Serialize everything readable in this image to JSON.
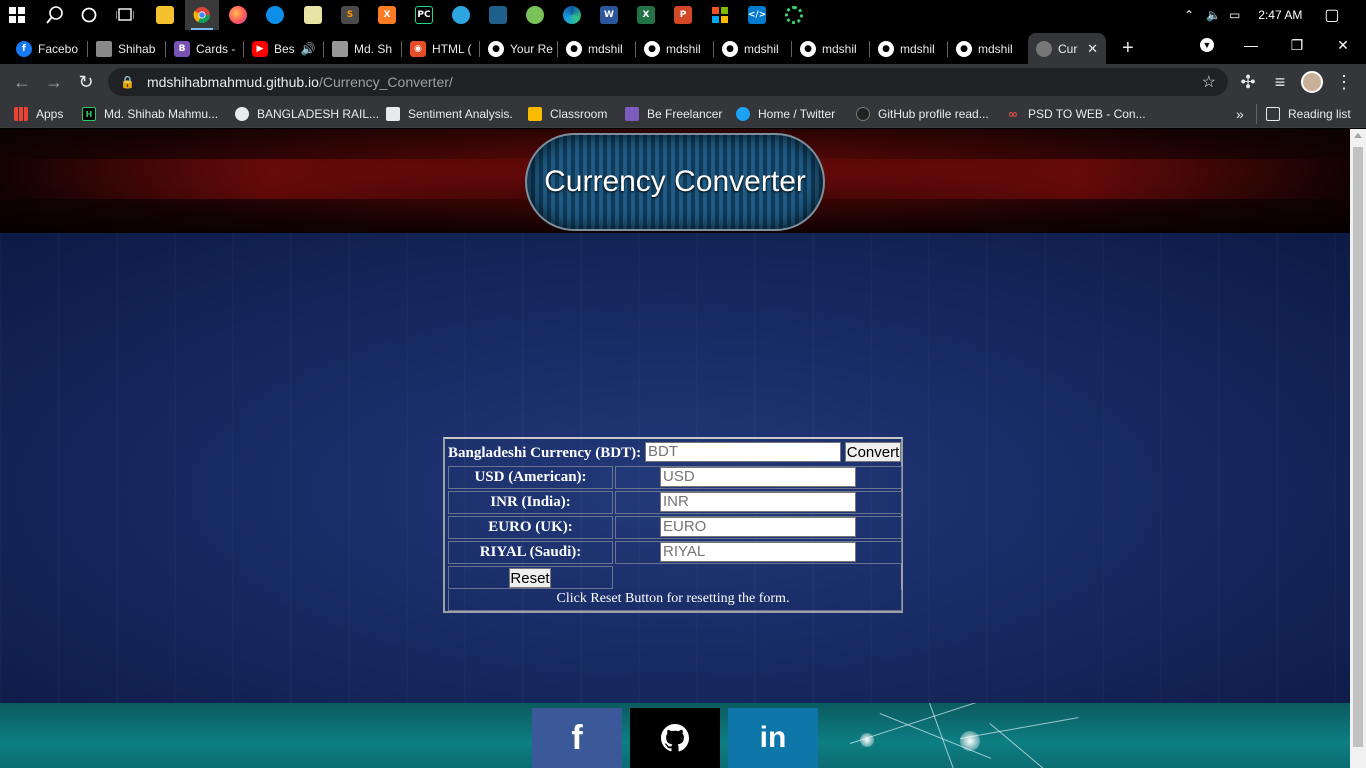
{
  "taskbar": {
    "time": "2:47 AM",
    "apps": [
      "start-icon",
      "search-icon",
      "cortana-icon",
      "task-view-icon",
      "file-explorer-icon",
      "chrome-icon",
      "firefox-icon",
      "teamviewer-icon",
      "notepad-icon",
      "sublime-icon",
      "xampp-icon",
      "pycharm-icon",
      "telegram-icon",
      "blend-icon",
      "android-icon",
      "edge-icon",
      "word-icon",
      "excel-icon",
      "powerpoint-icon",
      "office-icon",
      "vscode-icon",
      "recorder-icon"
    ],
    "colors": {
      "word": "#2b579a",
      "excel": "#217346",
      "powerpoint": "#d24726",
      "vscode": "#007acc"
    }
  },
  "tabs": [
    {
      "label": "Facebo",
      "icon": "facebook-icon"
    },
    {
      "label": "Shihab",
      "icon": "profile-icon"
    },
    {
      "label": "Cards -",
      "icon": "bootstrap-icon"
    },
    {
      "label": "Bes",
      "icon": "youtube-icon"
    },
    {
      "label": "Md. Sh",
      "icon": "profile-icon"
    },
    {
      "label": "HTML (",
      "icon": "html-icon"
    },
    {
      "label": "Your Re",
      "icon": "github-icon"
    },
    {
      "label": "mdshil",
      "icon": "github-icon"
    },
    {
      "label": "mdshil",
      "icon": "github-icon"
    },
    {
      "label": "mdshil",
      "icon": "github-icon"
    },
    {
      "label": "mdshil",
      "icon": "github-icon"
    },
    {
      "label": "mdshil",
      "icon": "github-icon"
    },
    {
      "label": "mdshil",
      "icon": "github-icon"
    },
    {
      "label": "Cur",
      "icon": "globe-icon",
      "active": true
    }
  ],
  "address": {
    "host": "mdshihabmahmud.github.io",
    "path": "/Currency_Converter/"
  },
  "bookmarks": [
    {
      "label": "Apps",
      "icon": "apps-icon"
    },
    {
      "label": "Md. Shihab Mahmu...",
      "icon": "hackerrank-icon"
    },
    {
      "label": "BANGLADESH RAIL...",
      "icon": "globe-icon"
    },
    {
      "label": "Sentiment Analysis.",
      "icon": "doc-icon"
    },
    {
      "label": "Classroom",
      "icon": "classroom-icon"
    },
    {
      "label": "Be Freelancer",
      "icon": "freelancer-icon"
    },
    {
      "label": "Home / Twitter",
      "icon": "twitter-icon"
    },
    {
      "label": "GitHub profile read...",
      "icon": "github-icon"
    },
    {
      "label": "PSD TO WEB - Con...",
      "icon": "link-icon"
    }
  ],
  "bookmarks_more": "»",
  "reading_list": "Reading list",
  "page": {
    "title": "Currency Converter",
    "converter": {
      "bdt_label": "Bangladeshi Currency (BDT):",
      "bdt_placeholder": "BDT",
      "convert_label": "Convert",
      "usd_label": "USD (American):",
      "usd_placeholder": "USD",
      "inr_label": "INR (India):",
      "inr_placeholder": "INR",
      "euro_label": "EURO (UK):",
      "euro_placeholder": "EURO",
      "riyal_label": "RIYAL (Saudi):",
      "riyal_placeholder": "RIYAL",
      "reset_label": "Reset",
      "note": "Click Reset Button for resetting the form."
    },
    "footer_links": [
      {
        "label": "f",
        "icon": "facebook-icon",
        "color": "#3b5998"
      },
      {
        "label": "",
        "icon": "github-icon",
        "color": "#000000"
      },
      {
        "label": "in",
        "icon": "linkedin-icon",
        "color": "#0e76a8"
      }
    ]
  }
}
